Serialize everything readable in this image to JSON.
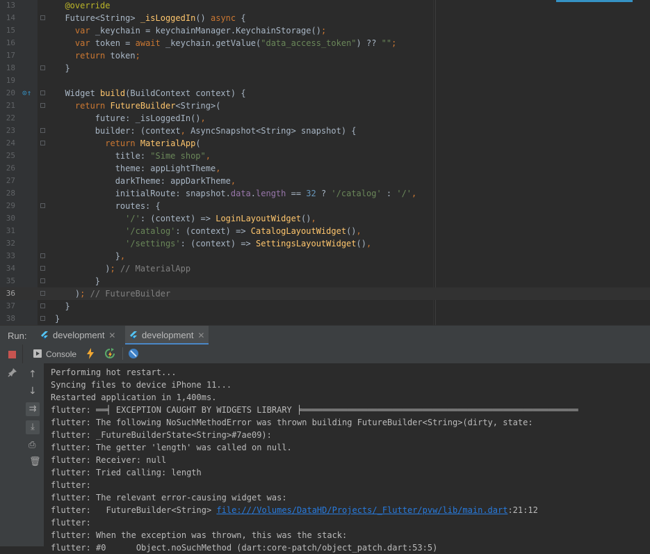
{
  "editor": {
    "lines": [
      {
        "num": "13",
        "html": "  <span class=\"ann\">@override</span>"
      },
      {
        "num": "14",
        "html": "  Future&lt;String&gt; <span class=\"fn\">_isLoggedIn</span>() <span class=\"kw\">async</span> {"
      },
      {
        "num": "15",
        "html": "    <span class=\"kw\">var</span> _keychain = keychainManager.KeychainStorage()<span class=\"kw\">;</span>"
      },
      {
        "num": "16",
        "html": "    <span class=\"kw\">var</span> token = <span class=\"kw\">await</span> _keychain.getValue(<span class=\"str\">\"data_access_token\"</span>) ?? <span class=\"str\">\"\"</span><span class=\"kw\">;</span>"
      },
      {
        "num": "17",
        "html": "    <span class=\"kw\">return</span> token<span class=\"kw\">;</span>"
      },
      {
        "num": "18",
        "html": "  }"
      },
      {
        "num": "19",
        "html": ""
      },
      {
        "num": "20",
        "html": "  Widget <span class=\"fn\">build</span>(BuildContext context) {"
      },
      {
        "num": "21",
        "html": "    <span class=\"kw\">return</span> <span class=\"fn\">FutureBuilder</span>&lt;String&gt;("
      },
      {
        "num": "22",
        "html": "        future: _isLoggedIn()<span class=\"kw\">,</span>"
      },
      {
        "num": "23",
        "html": "        builder: (context<span class=\"kw\">,</span> AsyncSnapshot&lt;String&gt; snapshot) {"
      },
      {
        "num": "24",
        "html": "          <span class=\"kw\">return</span> <span class=\"fn\">MaterialApp</span>("
      },
      {
        "num": "25",
        "html": "            title: <span class=\"str\">\"Sime shop\"</span><span class=\"kw\">,</span>"
      },
      {
        "num": "26",
        "html": "            theme: appLightTheme<span class=\"kw\">,</span>"
      },
      {
        "num": "27",
        "html": "            darkTheme: appDarkTheme<span class=\"kw\">,</span>"
      },
      {
        "num": "28",
        "html": "            initialRoute: snapshot.<span class=\"prop\">data</span>.<span class=\"prop\">length</span> == <span class=\"num-lit\">32</span> ? <span class=\"str\">'/catalog'</span> : <span class=\"str\">'/'</span><span class=\"kw\">,</span>"
      },
      {
        "num": "29",
        "html": "            routes: {"
      },
      {
        "num": "30",
        "html": "              <span class=\"str\">'/'</span>: (context) =&gt; <span class=\"fn\">LoginLayoutWidget</span>()<span class=\"kw\">,</span>"
      },
      {
        "num": "31",
        "html": "              <span class=\"str\">'/catalog'</span>: (context) =&gt; <span class=\"fn\">CatalogLayoutWidget</span>()<span class=\"kw\">,</span>"
      },
      {
        "num": "32",
        "html": "              <span class=\"str\">'/settings'</span>: (context) =&gt; <span class=\"fn\">SettingsLayoutWidget</span>()<span class=\"kw\">,</span>"
      },
      {
        "num": "33",
        "html": "            }<span class=\"kw\">,</span>"
      },
      {
        "num": "34",
        "html": "          )<span class=\"kw\">;</span> <span class=\"com\">// MaterialApp</span>"
      },
      {
        "num": "35",
        "html": "        }"
      },
      {
        "num": "36",
        "html": "    )<span class=\"kw\">;</span> <span class=\"com\">// FutureBuilder</span>"
      },
      {
        "num": "37",
        "html": "  }"
      },
      {
        "num": "38",
        "html": "}"
      }
    ]
  },
  "run": {
    "label": "Run:",
    "tabs": [
      {
        "label": "development",
        "active": false
      },
      {
        "label": "development",
        "active": true
      }
    ]
  },
  "toolbar": {
    "console_label": "Console"
  },
  "console": {
    "lines": [
      {
        "text": "Performing hot restart..."
      },
      {
        "text": "Syncing files to device iPhone 11..."
      },
      {
        "text": "Restarted application in 1,400ms."
      },
      {
        "text": "flutter: ══╡ EXCEPTION CAUGHT BY WIDGETS LIBRARY ╞═══════════════════════════════════════════════════════"
      },
      {
        "text": "flutter: The following NoSuchMethodError was thrown building FutureBuilder<String>(dirty, state:"
      },
      {
        "text": "flutter: _FutureBuilderState<String>#7ae09):"
      },
      {
        "text": "flutter: The getter 'length' was called on null."
      },
      {
        "text": "flutter: Receiver: null"
      },
      {
        "text": "flutter: Tried calling: length"
      },
      {
        "text": "flutter:"
      },
      {
        "text": "flutter: The relevant error-causing widget was:"
      },
      {
        "text": "flutter:   FutureBuilder<String> ",
        "link": "file:///Volumes/DataHD/Projects/_Flutter/pvw/lib/main.dart",
        "after": ":21:12"
      },
      {
        "text": "flutter:"
      },
      {
        "text": "flutter: When the exception was thrown, this was the stack:"
      },
      {
        "text": "flutter: #0      Object.noSuchMethod (dart:core-patch/object_patch.dart:53:5)"
      }
    ]
  },
  "colors": {
    "accent": "#4a88c7",
    "stop": "#c75450",
    "link": "#287bde"
  }
}
